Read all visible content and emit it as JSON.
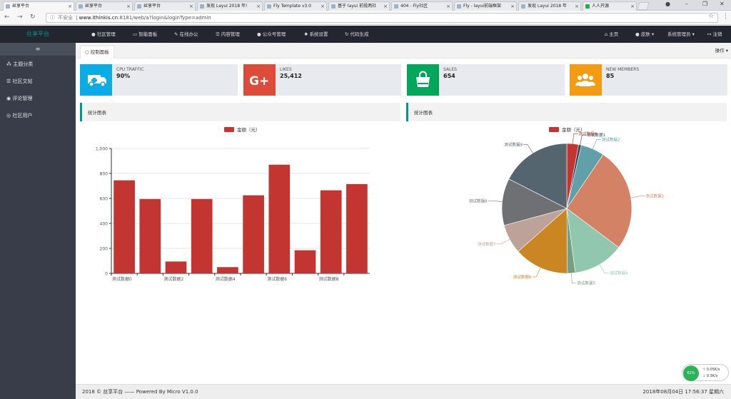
{
  "browser": {
    "tabs": [
      {
        "label": "丝享平台"
      },
      {
        "label": "丝享平台"
      },
      {
        "label": "丝享平台"
      },
      {
        "label": "发现 Layui 2018 年!"
      },
      {
        "label": "Fly Template v3.0"
      },
      {
        "label": "基于 layui 前段两社"
      },
      {
        "label": "404 - Fly社区"
      },
      {
        "label": "Fly - layui前端框架"
      },
      {
        "label": "发现 Layui 2018 年"
      },
      {
        "label": "人人开源"
      }
    ],
    "security_label": "不安全",
    "url_host": "www.ithinkis.cn",
    "url_rest": ":8181/web/a?login&loginType=admin"
  },
  "header": {
    "logo": "丝享平台",
    "nav": [
      "社区管理",
      "智能面板",
      "在线办公",
      "内容管理",
      "公众号管理",
      "系统设置",
      "代码生成"
    ],
    "right": [
      "主页",
      "皮肤",
      "系统管理员",
      "注销"
    ]
  },
  "sidebar": {
    "toggle": "≡",
    "items": [
      {
        "label": "主题分类"
      },
      {
        "label": "社区文帖"
      },
      {
        "label": "评论管理"
      },
      {
        "label": "社区用户"
      }
    ]
  },
  "content_tab": {
    "label": "控制面板",
    "ops": "操作"
  },
  "cards": [
    {
      "title": "CPU TRAFFIC",
      "value": "90%",
      "color": "#0aace6",
      "icon": "ambulance-icon"
    },
    {
      "title": "LIKES",
      "value": "25,412",
      "color": "#dd4b39",
      "icon": "google-plus-icon"
    },
    {
      "title": "SALES",
      "value": "654",
      "color": "#00a65a",
      "icon": "shopping-bag-icon"
    },
    {
      "title": "NEW MEMBERS",
      "value": "85",
      "color": "#f39c12",
      "icon": "users-icon"
    }
  ],
  "panels": [
    {
      "title": "统计图表"
    },
    {
      "title": "统计图表"
    }
  ],
  "chart_data": [
    {
      "type": "bar",
      "legend": [
        "金额（元）"
      ],
      "categories": [
        "测试数据0",
        "测试数据1",
        "测试数据2",
        "测试数据3",
        "测试数据4",
        "测试数据5",
        "测试数据6",
        "测试数据7",
        "测试数据8",
        "测试数据9"
      ],
      "tick_labels": [
        "测试数据0",
        "测试数据2",
        "测试数据4",
        "测试数据6",
        "测试数据8"
      ],
      "values": [
        745,
        595,
        95,
        595,
        50,
        625,
        870,
        185,
        665,
        715
      ],
      "ylim": [
        0,
        1000
      ],
      "yticks": [
        "0",
        "200",
        "400",
        "600",
        "800",
        "1,000"
      ],
      "color": "#c23531",
      "grid": true
    },
    {
      "type": "pie",
      "legend": [
        "金额（元）"
      ],
      "slices": [
        {
          "label": "测试数据0",
          "value": 30,
          "color": "#c23531"
        },
        {
          "label": "测试数据1",
          "value": 7,
          "color": "#2f4554"
        },
        {
          "label": "测试数据2",
          "value": 60,
          "color": "#61a0a8"
        },
        {
          "label": "测试数据3",
          "value": 265,
          "color": "#d48265"
        },
        {
          "label": "测试数据4",
          "value": 130,
          "color": "#91c7ae"
        },
        {
          "label": "测试数据5",
          "value": 20,
          "color": "#749f83"
        },
        {
          "label": "测试数据6",
          "value": 140,
          "color": "#ca8622"
        },
        {
          "label": "测试数据7",
          "value": 75,
          "color": "#bda29a"
        },
        {
          "label": "测试数据8",
          "value": 120,
          "color": "#6e7074"
        },
        {
          "label": "测试数据9",
          "value": 180,
          "color": "#546570"
        }
      ]
    }
  ],
  "footer": {
    "left": "2018 © 丝享平台 —— Powered By Micro V1.0.0",
    "right": "2018年08月04日 17:56:37 星期六"
  },
  "net_widget": {
    "badge": "61%",
    "up": "0.05K/s",
    "down": "0.3K/s"
  }
}
